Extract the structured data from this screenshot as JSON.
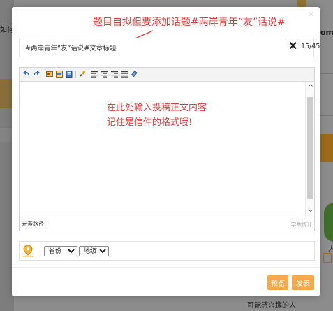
{
  "background": {
    "left_text": "如何",
    "right_text": "om",
    "right_number": "大",
    "bottom_text": "可能感兴趣的人"
  },
  "modal": {
    "close_label": "×",
    "annotation_title_hint": "题目自拟但要添加话题#两岸青年“友”话说#",
    "title_field": {
      "value": "#两岸青年“友”话说#文章标题",
      "clear_label": "✕",
      "char_count": "15/45"
    },
    "editor": {
      "toolbar": [
        "undo-icon",
        "redo-icon",
        "image-icon",
        "gallery-icon",
        "document-icon",
        "format-brush-icon",
        "align-left-icon",
        "align-center-icon",
        "align-right-icon",
        "justify-icon",
        "eraser-icon"
      ],
      "content_hint_line1": "在此处输入投稿正文内容",
      "content_hint_line2": "记住是信件的格式哦!",
      "scroll_up": "^",
      "scroll_down": "⌄",
      "path_label": "元素路径:",
      "word_count_label": "字数统计"
    },
    "location": {
      "pin_icon": "location-pin-icon",
      "province_selected": "省份",
      "city_selected": "地级市"
    },
    "buttons": {
      "preview_label": "预览",
      "publish_label": "发表"
    }
  },
  "colors": {
    "accent_orange": "#f5a94a",
    "annotation_red": "#e03c3c",
    "pin_yellow": "#f3b63a"
  }
}
